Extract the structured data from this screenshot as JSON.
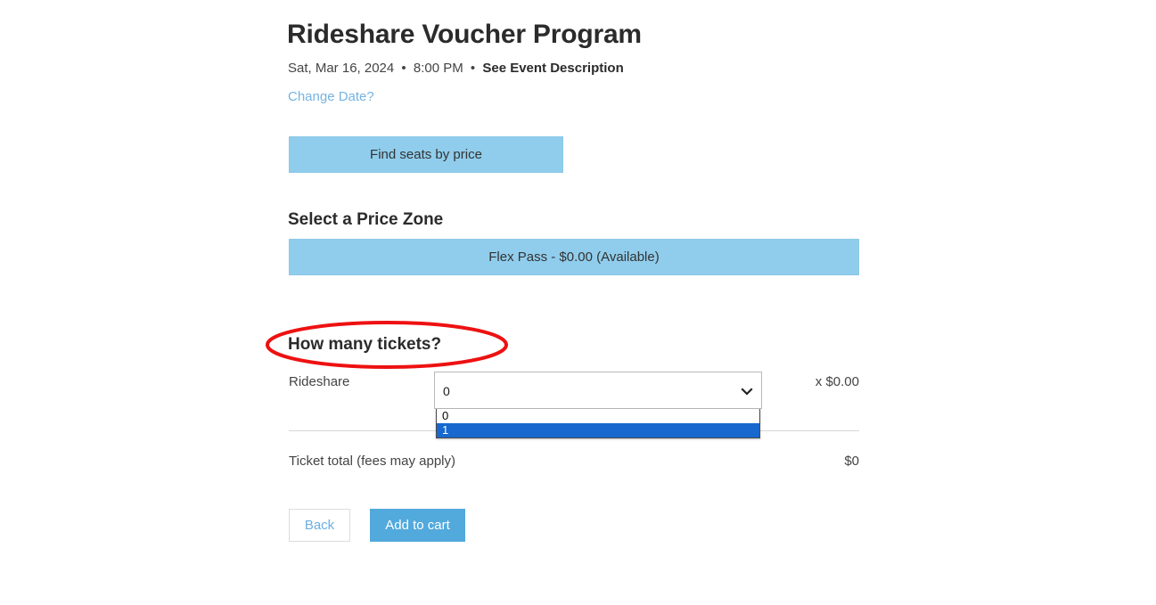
{
  "event": {
    "title": "Rideshare Voucher Program",
    "date": "Sat, Mar 16, 2024",
    "separator": "•",
    "time": "8:00 PM",
    "description_link": "See Event Description",
    "change_date_label": "Change Date?"
  },
  "find_seats": {
    "label": "Find seats by price"
  },
  "price_zone": {
    "heading": "Select a Price Zone",
    "options": [
      {
        "label": "Flex Pass - $0.00 (Available)",
        "name": "Flex Pass",
        "price": "$0.00",
        "status": "Available",
        "selected": true
      }
    ]
  },
  "tickets": {
    "heading": "How many tickets?",
    "row": {
      "label": "Rideshare",
      "selected_quantity": "0",
      "quantity_options": [
        "0",
        "1"
      ],
      "highlighted_option": "1",
      "unit_price": "x $0.00"
    },
    "total_label": "Ticket total (fees may apply)",
    "total_value": "$0"
  },
  "footer": {
    "back_label": "Back",
    "add_to_cart_label": "Add to cart"
  },
  "annotation": {
    "type": "ellipse-highlight",
    "target": "How many tickets?",
    "color": "#ee1111"
  },
  "colors": {
    "light_blue": "#90cdec",
    "primary_blue": "#52a9dc",
    "link_blue": "#76b3e2",
    "dropdown_highlight": "#1868cd",
    "annotation_red": "#ee1111"
  },
  "icons": {
    "chevron_down": "chevron-down-icon"
  }
}
